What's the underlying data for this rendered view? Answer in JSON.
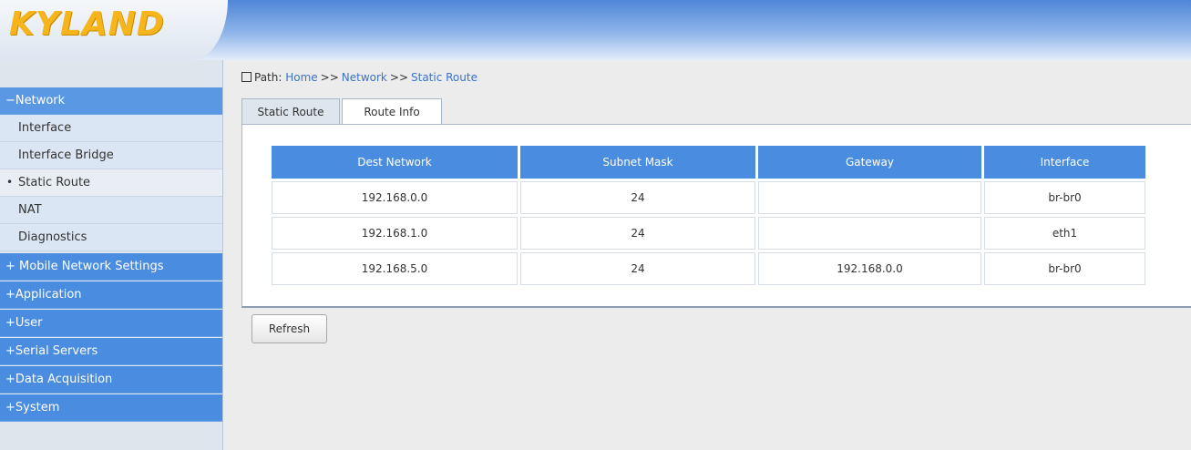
{
  "brand": {
    "logo_text": "KYLAND",
    "logo_color": "#f6b51a"
  },
  "sidebar": {
    "network": {
      "label": "−Network"
    },
    "subitems": [
      {
        "label": "Interface"
      },
      {
        "label": "Interface Bridge"
      },
      {
        "label": "Static Route",
        "bullet": "•"
      },
      {
        "label": "NAT"
      },
      {
        "label": "Diagnostics"
      }
    ],
    "sections": [
      {
        "label": "+ Mobile Network Settings"
      },
      {
        "label": "+Application"
      },
      {
        "label": "+User"
      },
      {
        "label": "+Serial Servers"
      },
      {
        "label": "+Data Acquisition"
      },
      {
        "label": "+System"
      }
    ]
  },
  "breadcrumb": {
    "prefix": "Path:",
    "items": [
      "Home",
      "Network",
      "Static Route"
    ],
    "separator": ">>"
  },
  "tabs": [
    {
      "label": "Static Route"
    },
    {
      "label": "Route Info"
    }
  ],
  "route_table": {
    "columns": [
      "Dest Network",
      "Subnet Mask",
      "Gateway",
      "Interface"
    ],
    "rows": [
      [
        "192.168.0.0",
        "24",
        "",
        "br-br0"
      ],
      [
        "192.168.1.0",
        "24",
        "",
        "eth1"
      ],
      [
        "192.168.5.0",
        "24",
        "192.168.0.0",
        "br-br0"
      ]
    ]
  },
  "actions": {
    "refresh_label": "Refresh"
  },
  "colors": {
    "accent": "#4a8de0",
    "link": "#3b73c6"
  }
}
